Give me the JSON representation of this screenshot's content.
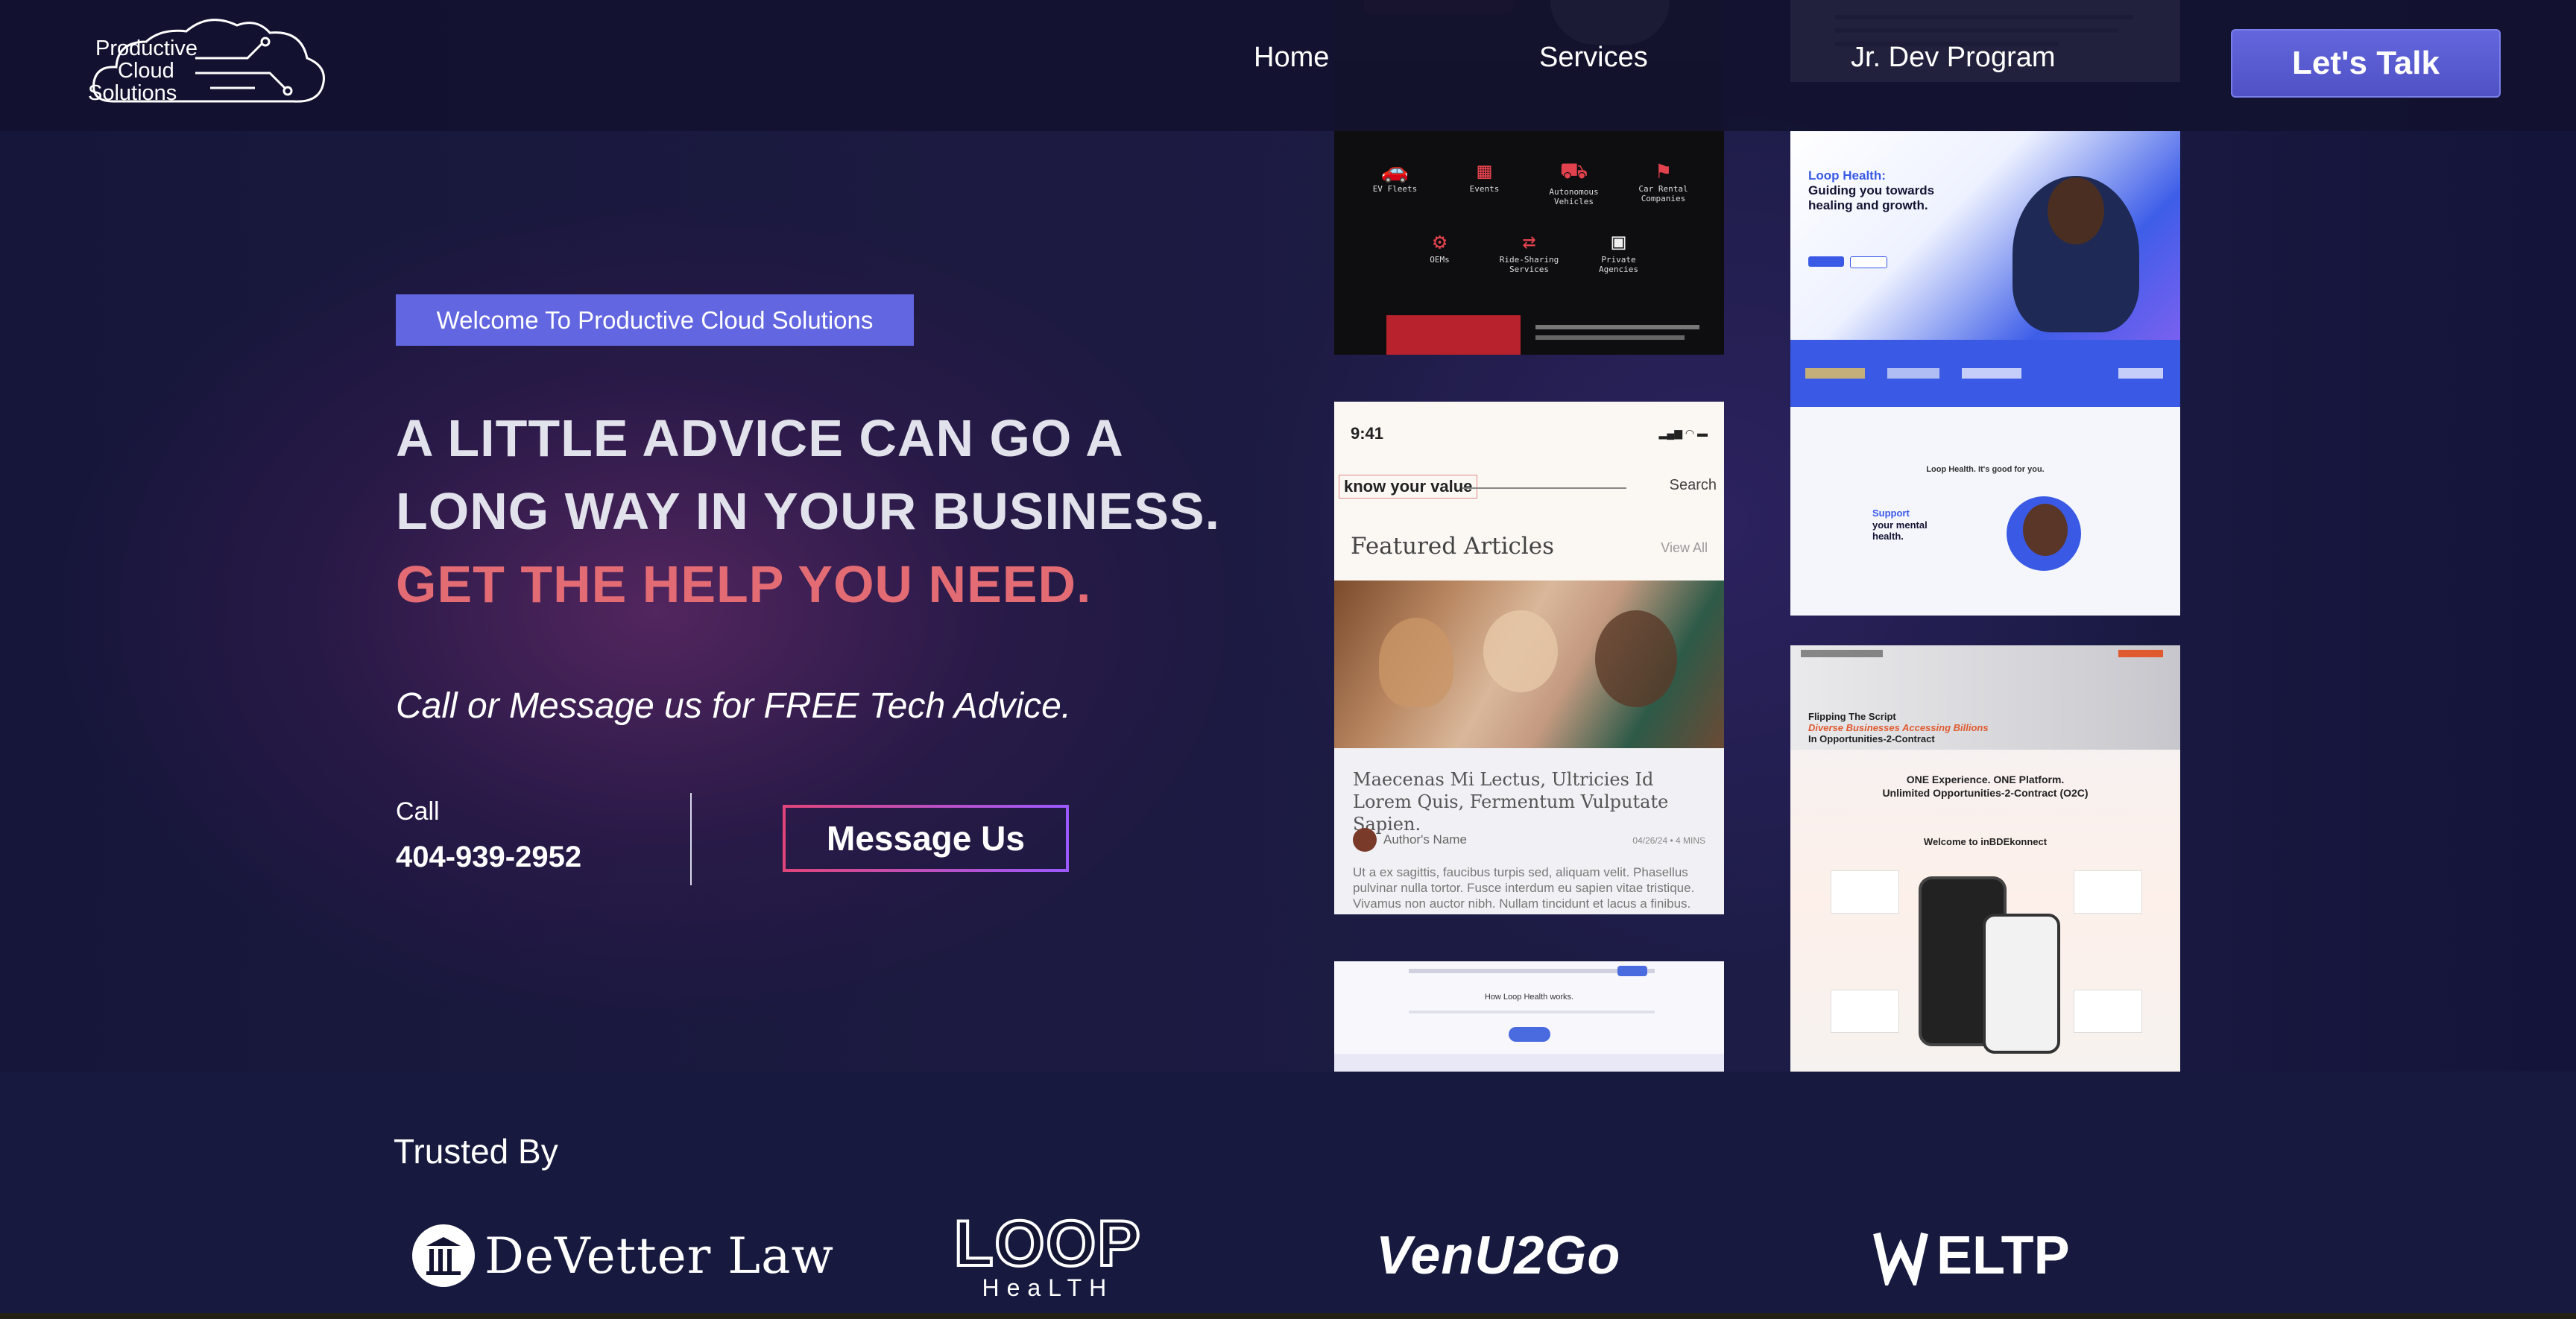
{
  "brand": {
    "logo_line1": "Productive",
    "logo_line2": "Cloud",
    "logo_line3": "Solutions"
  },
  "nav": {
    "items": [
      {
        "label": "Home"
      },
      {
        "label": "Services"
      },
      {
        "label": "Jr. Dev Program"
      }
    ],
    "cta_label": "Let's Talk"
  },
  "hero": {
    "welcome": "Welcome To Productive Cloud Solutions",
    "headline_line1": "A LITTLE ADVICE CAN GO A",
    "headline_line2": "LONG WAY IN YOUR BUSINESS.",
    "headline_line3": "GET THE HELP YOU NEED.",
    "subline": "Call or Message us for FREE Tech Advice.",
    "call_label": "Call",
    "phone": "404-939-2952",
    "message_button": "Message Us"
  },
  "showcase": {
    "ev_icons": [
      "EV Fleets",
      "Events",
      "Autonomous Vehicles",
      "Car Rental Companies",
      "OEMs",
      "Ride-Sharing Services",
      "Private Agencies"
    ],
    "article_app": {
      "time": "9:41",
      "brand": "know your value",
      "search": "Search",
      "section": "Featured Articles",
      "view_all": "View All",
      "article_title": "Maecenas Mi Lectus, Ultricies Id Lorem Quis, Fermentum Vulputate Sapien.",
      "author": "Author's Name",
      "date": "04/26/24 • 4 MINS",
      "excerpt": "Ut a ex sagittis, faucibus turpis sed, aliquam velit. Phasellus pulvinar nulla tortor. Fusce interdum eu sapien vitae tristique. Vivamus non auctor nibh. Nullam tincidunt et lacus a finibus."
    },
    "loop_health": {
      "headline_prefix": "Loop Health:",
      "headline": "Guiding you towards healing and growth.",
      "tagline": "Loop Health. It's good for you.",
      "support": "Support",
      "support_rest": "your mental health.",
      "how": "How Loop Health works."
    },
    "connect": {
      "headline1": "Flipping The Script",
      "headline2": "Diverse Businesses Accessing Billions",
      "headline3": "In Opportunities-2-Contract",
      "mid1": "ONE Experience. ONE Platform.",
      "mid2": "Unlimited Opportunities-2-Contract (O2C)",
      "welcome": "Welcome to inBDEkonnect"
    }
  },
  "trusted": {
    "title": "Trusted By",
    "partners": [
      {
        "name": "DeVetter Law"
      },
      {
        "name": "LOOP",
        "sub": "HeaLTH"
      },
      {
        "name": "VenU2Go"
      },
      {
        "name": "ELTP"
      }
    ]
  },
  "colors": {
    "accent": "#6266e0",
    "highlight": "#e26b74",
    "background": "#141433",
    "trusted_bg": "#171a3e"
  }
}
